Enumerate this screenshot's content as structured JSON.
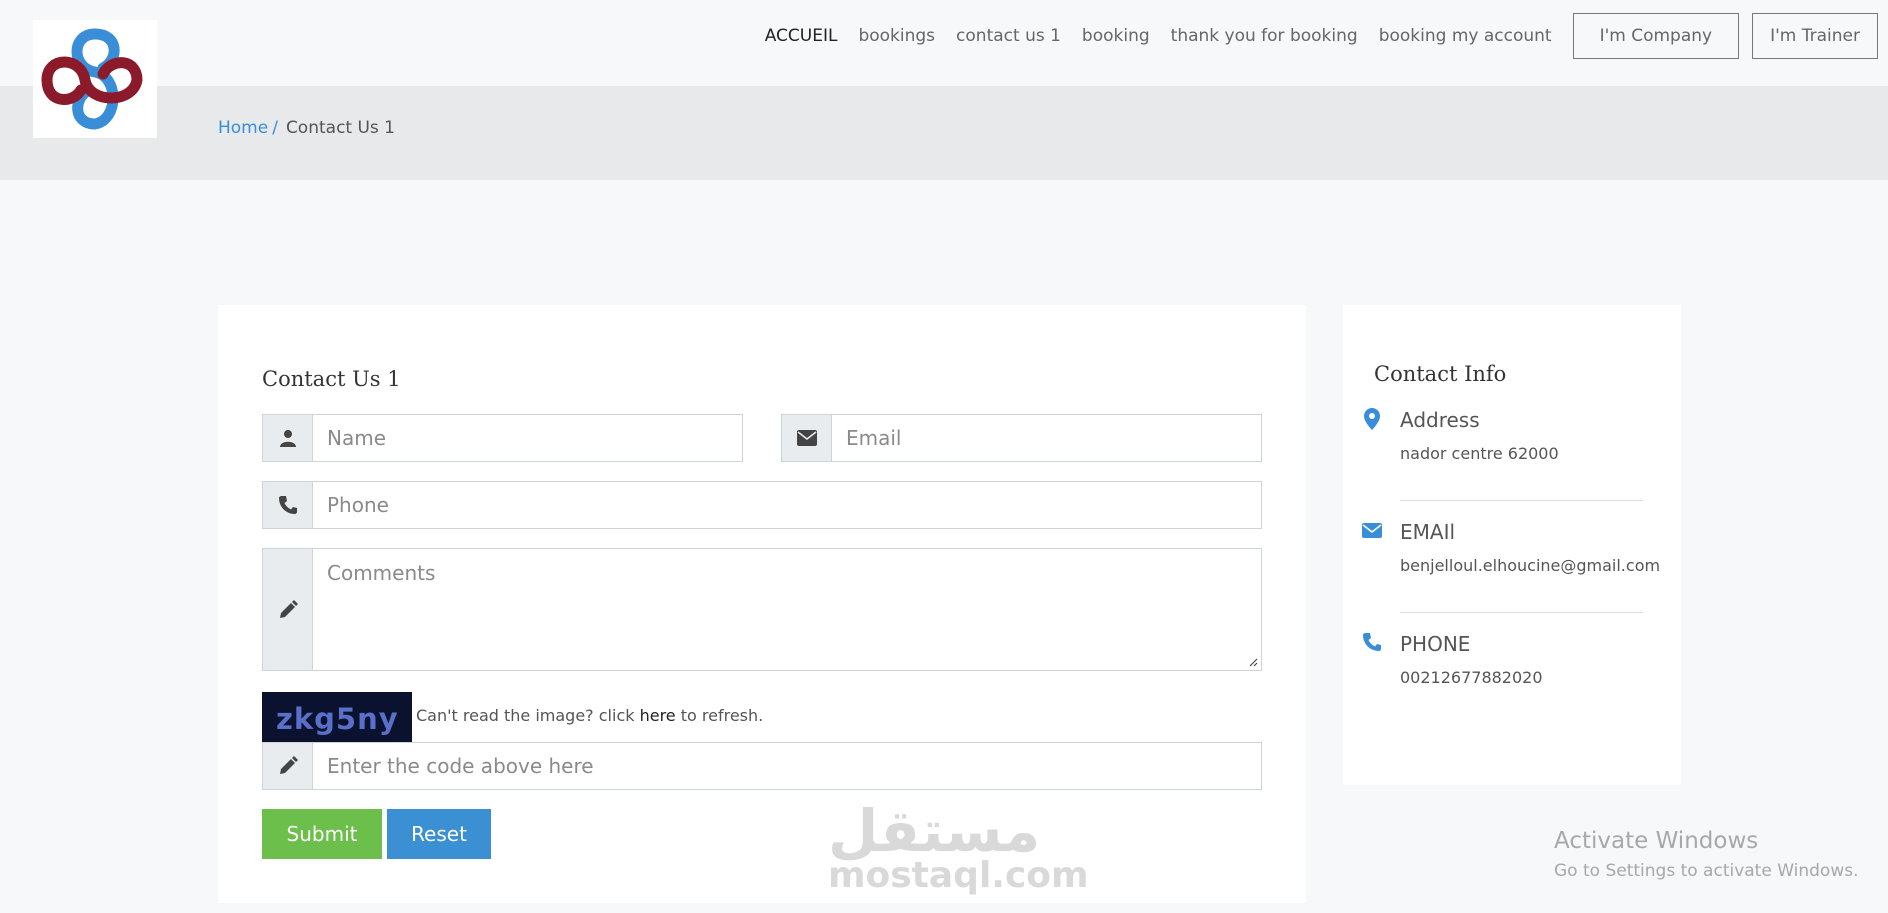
{
  "nav": {
    "links": [
      "ACCUEIL",
      "bookings",
      "contact us 1",
      "booking",
      "thank you for booking",
      "booking my account"
    ],
    "company_button": "I'm Company",
    "trainer_button": "I'm Trainer"
  },
  "breadcrumb": {
    "home": "Home",
    "separator": "/",
    "current": "Contact Us 1"
  },
  "form": {
    "title": "Contact Us 1",
    "name_placeholder": "Name",
    "email_placeholder": "Email",
    "phone_placeholder": "Phone",
    "comments_placeholder": "Comments",
    "captcha_code": "zkg5ny",
    "captcha_prefix": "Can't read the image? click",
    "captcha_link": "here",
    "captcha_suffix": "to refresh.",
    "code_placeholder": "Enter the code above here",
    "submit_label": "Submit",
    "reset_label": "Reset"
  },
  "contact_info": {
    "title": "Contact Info",
    "address_label": "Address",
    "address_value": "nador centre 62000",
    "email_label": "EMAIl",
    "email_value": "benjelloul.elhoucine@gmail.com",
    "phone_label": "PHONE",
    "phone_value": "00212677882020"
  },
  "watermark": {
    "arabic": "مستقل",
    "latin": "mostaql.com"
  },
  "windows_activation": {
    "title": "Activate Windows",
    "subtitle": "Go to Settings to activate Windows."
  },
  "colors": {
    "accent_blue": "#3a8ed8",
    "submit_green": "#6cbf4a",
    "reset_blue": "#3b8fd3",
    "logo_red": "#8b1a2b",
    "logo_blue": "#3a8ed8"
  },
  "icons": {
    "name": "user-icon",
    "email": "envelope-icon",
    "phone": "phone-icon",
    "comments": "pencil-icon",
    "code": "pencil-icon",
    "address": "map-marker-icon"
  }
}
